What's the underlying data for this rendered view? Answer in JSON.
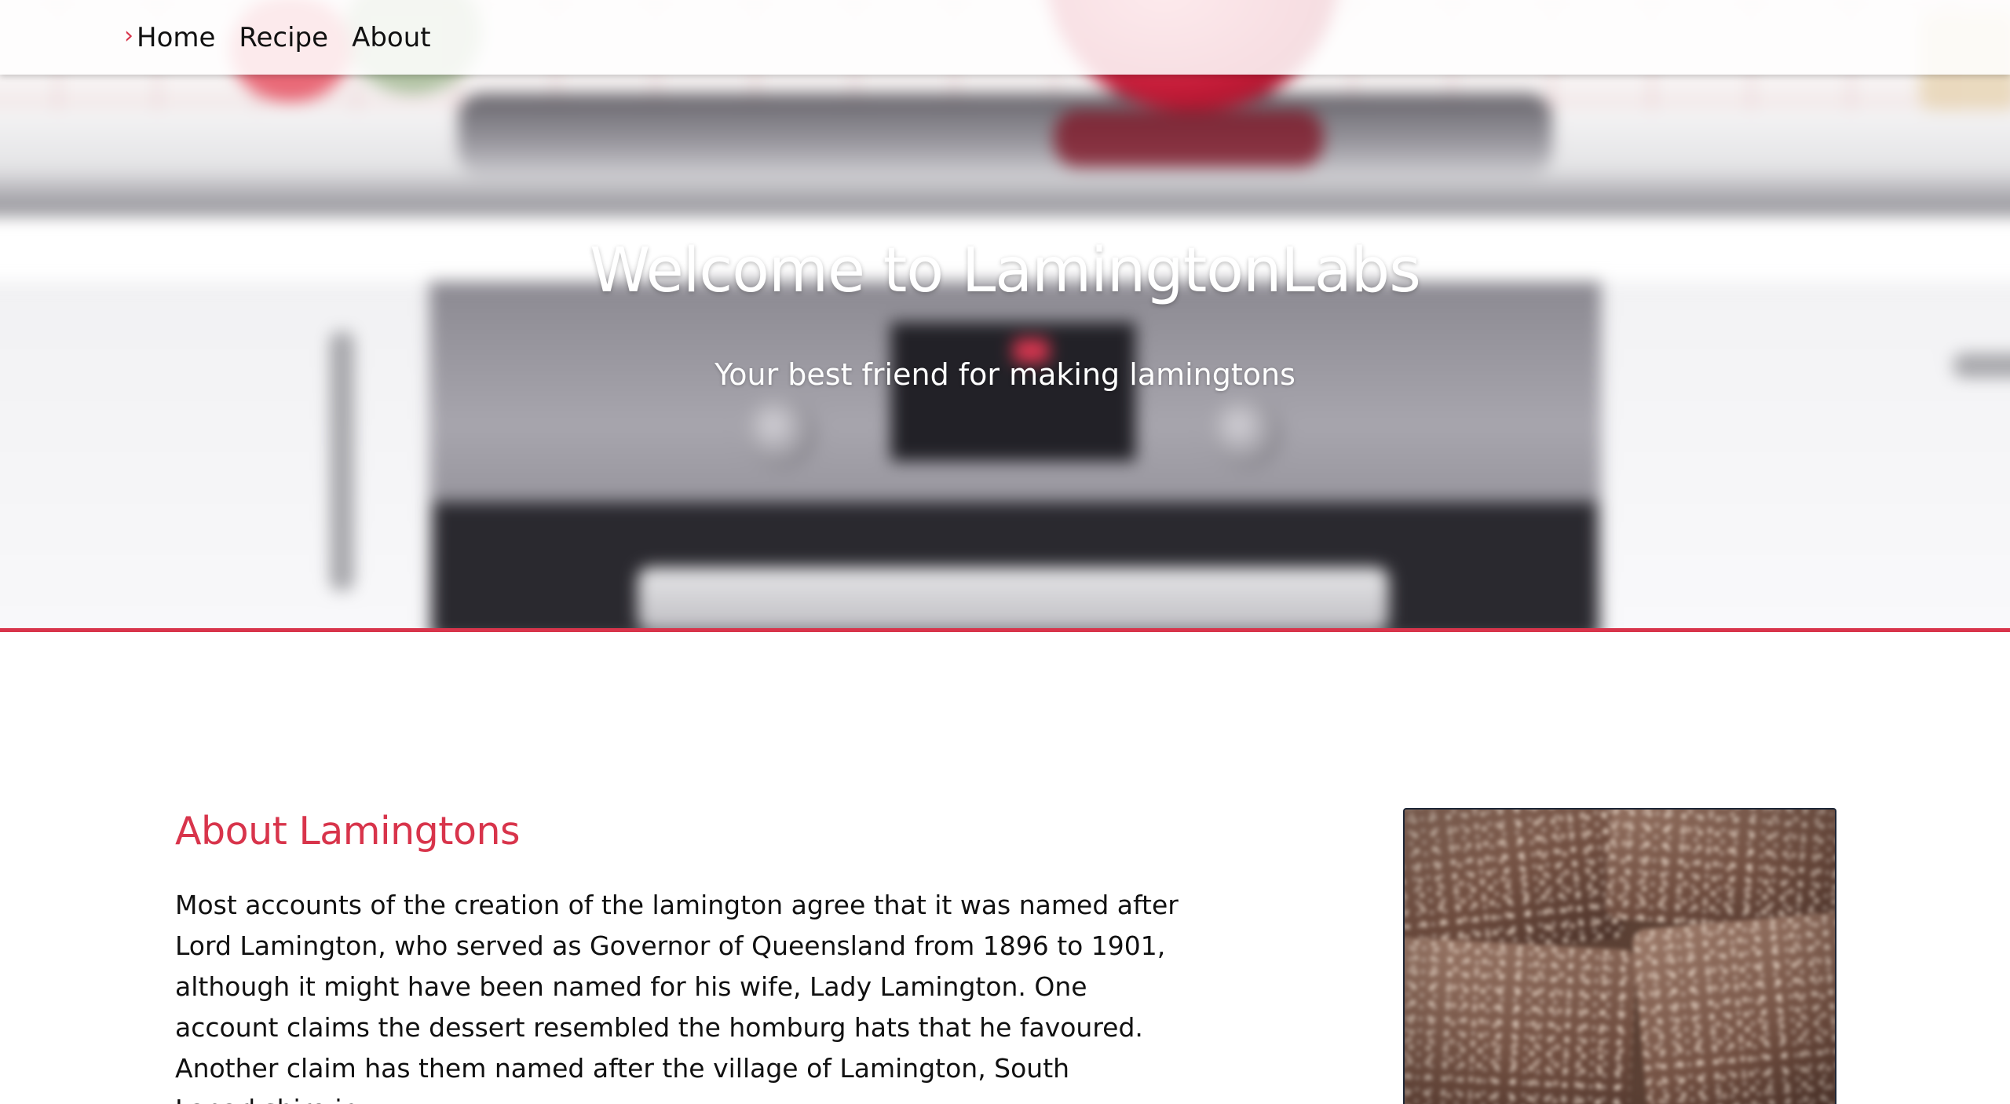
{
  "nav": {
    "items": [
      {
        "label": "Home",
        "active": true
      },
      {
        "label": "Recipe",
        "active": false
      },
      {
        "label": "About",
        "active": false
      }
    ],
    "active_marker": "chevron-right-icon"
  },
  "hero": {
    "title": "Welcome to LamingtonLabs",
    "subtitle": "Your best friend for making lamingtons"
  },
  "about": {
    "heading": "About Lamingtons",
    "paragraph": "Most accounts of the creation of the lamington agree that it was named after Lord Lamington, who served as Governor of Queensland from 1896 to 1901, although it might have been named for his wife, Lady Lamington. One account claims the dessert resembled the homburg hats that he favoured. Another claim has them named after the village of Lamington, South Lanarkshire in"
  },
  "colors": {
    "accent": "#d8344b",
    "text": "#111111",
    "hero_text": "#ffffff",
    "photo_border": "#1d2636"
  }
}
